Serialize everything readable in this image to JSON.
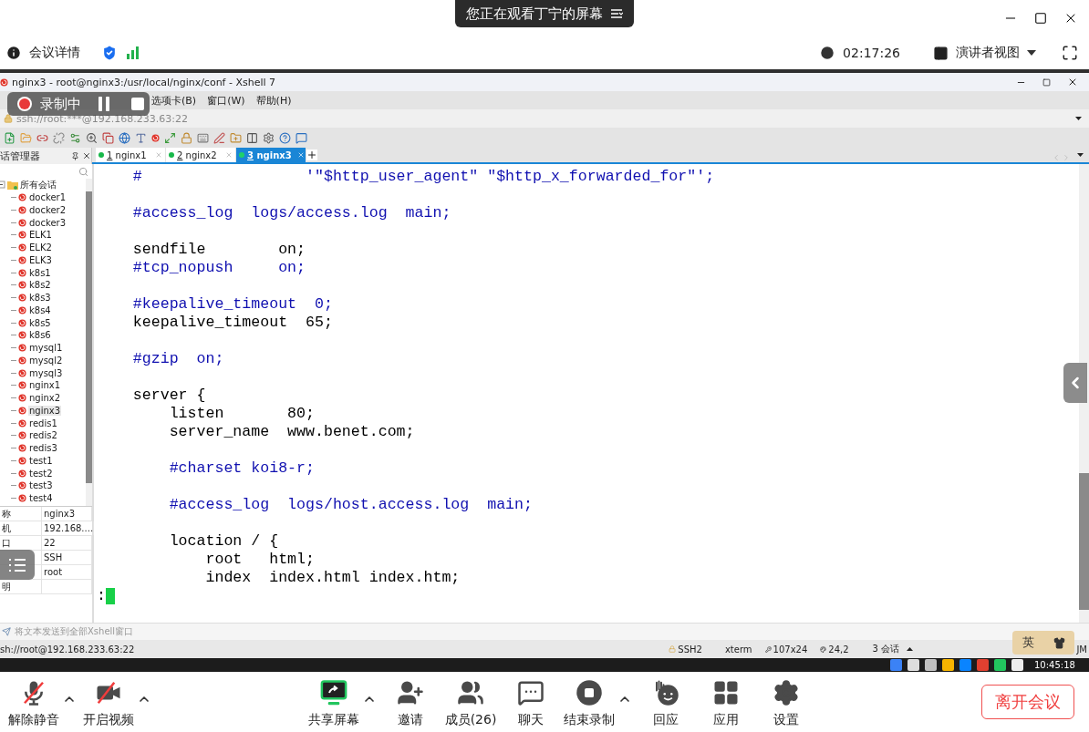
{
  "meeting_bar": {
    "title": "您正在观看丁宁的屏幕"
  },
  "info_bar": {
    "details_label": "会议详情",
    "timer": "02:17:26",
    "view_label": "演讲者视图"
  },
  "recording": {
    "label": "录制中"
  },
  "xshell": {
    "title": "nginx3 - root@nginx3:/usr/local/nginx/conf - Xshell 7",
    "menu": [
      "选项卡(B)",
      "窗口(W)",
      "帮助(H)"
    ],
    "address": "ssh://root:***@192.168.233.63:22",
    "session_manager": {
      "title": "话管理器"
    },
    "tree": {
      "label": "所有会话",
      "expanded": true,
      "children": [
        {
          "label": "docker1",
          "selected": false
        },
        {
          "label": "docker2",
          "selected": false
        },
        {
          "label": "docker3",
          "selected": false
        },
        {
          "label": "ELK1",
          "selected": false
        },
        {
          "label": "ELK2",
          "selected": false
        },
        {
          "label": "ELK3",
          "selected": false
        },
        {
          "label": "k8s1",
          "selected": false
        },
        {
          "label": "k8s2",
          "selected": false
        },
        {
          "label": "k8s3",
          "selected": false
        },
        {
          "label": "k8s4",
          "selected": false
        },
        {
          "label": "k8s5",
          "selected": false
        },
        {
          "label": "k8s6",
          "selected": false
        },
        {
          "label": "mysql1",
          "selected": false
        },
        {
          "label": "mysql2",
          "selected": false
        },
        {
          "label": "mysql3",
          "selected": false
        },
        {
          "label": "nginx1",
          "selected": false
        },
        {
          "label": "nginx2",
          "selected": false
        },
        {
          "label": "nginx3",
          "selected": true
        },
        {
          "label": "redis1",
          "selected": false
        },
        {
          "label": "redis2",
          "selected": false
        },
        {
          "label": "redis3",
          "selected": false
        },
        {
          "label": "test1",
          "selected": false
        },
        {
          "label": "test2",
          "selected": false
        },
        {
          "label": "test3",
          "selected": false
        },
        {
          "label": "test4",
          "selected": false
        }
      ]
    },
    "properties": [
      {
        "name": "称",
        "value": "nginx3"
      },
      {
        "name": "机",
        "value": "192.168...."
      },
      {
        "name": "口",
        "value": "22"
      },
      {
        "value": "SSH"
      },
      {
        "value": "root"
      },
      {
        "name": "明"
      }
    ],
    "tabs": [
      {
        "number": "1",
        "label": "nginx1",
        "selected": false
      },
      {
        "number": "2",
        "label": "nginx2",
        "selected": false
      },
      {
        "number": "3",
        "label": "nginx3",
        "selected": true
      }
    ],
    "terminal_lines": [
      {
        "kind": "comment",
        "text": "    #                  '\"$http_user_agent\" \"$http_x_forwarded_for\"';"
      },
      {
        "kind": "blank"
      },
      {
        "kind": "comment",
        "text": "    #access_log  logs/access.log  main;"
      },
      {
        "kind": "blank"
      },
      {
        "kind": "code",
        "text": "    sendfile        on;"
      },
      {
        "kind": "comment",
        "text": "    #tcp_nopush     on;"
      },
      {
        "kind": "blank"
      },
      {
        "kind": "comment",
        "text": "    #keepalive_timeout  0;"
      },
      {
        "kind": "code",
        "text": "    keepalive_timeout  65;"
      },
      {
        "kind": "blank"
      },
      {
        "kind": "comment",
        "text": "    #gzip  on;"
      },
      {
        "kind": "blank"
      },
      {
        "kind": "code",
        "text": "    server {"
      },
      {
        "kind": "code",
        "text": "        listen       80;"
      },
      {
        "kind": "code",
        "text": "        server_name  www.benet.com;"
      },
      {
        "kind": "blank"
      },
      {
        "kind": "comment",
        "text": "        #charset koi8-r;"
      },
      {
        "kind": "blank"
      },
      {
        "kind": "comment",
        "text": "        #access_log  logs/host.access.log  main;"
      },
      {
        "kind": "blank"
      },
      {
        "kind": "code",
        "text": "        location / {"
      },
      {
        "kind": "code",
        "text": "            root   html;"
      },
      {
        "kind": "code",
        "text": "            index  index.html index.htm;"
      },
      {
        "kind": "prompt",
        "text": ":"
      }
    ],
    "send_bar": "将文本发送到全部Xshell窗口",
    "status_bar": {
      "connection": "sh://root@192.168.233.63:22",
      "protocol": "SSH2",
      "terminal": "xterm",
      "size": "107x24",
      "cursor": "24,2",
      "sessions": "3 会话",
      "tail": "JM"
    }
  },
  "ime": {
    "label": "英"
  },
  "taskbar": {
    "time": "10:45:18"
  },
  "toolbar": [
    {
      "kind": "mic",
      "label": "解除静音",
      "caret": true
    },
    {
      "kind": "video",
      "label": "开启视频",
      "caret": true
    },
    {
      "kind": "share",
      "label": "共享屏幕",
      "caret": true
    },
    {
      "kind": "invite",
      "label": "邀请",
      "caret": false
    },
    {
      "kind": "members",
      "label": "成员(26)",
      "caret": false
    },
    {
      "kind": "chat",
      "label": "聊天",
      "caret": false
    },
    {
      "kind": "record",
      "label": "结束录制",
      "caret": true
    },
    {
      "kind": "react",
      "label": "回应",
      "caret": false
    },
    {
      "kind": "apps",
      "label": "应用",
      "caret": false
    },
    {
      "kind": "settings",
      "label": "设置",
      "caret": false
    }
  ],
  "leave_button": "离开会议"
}
